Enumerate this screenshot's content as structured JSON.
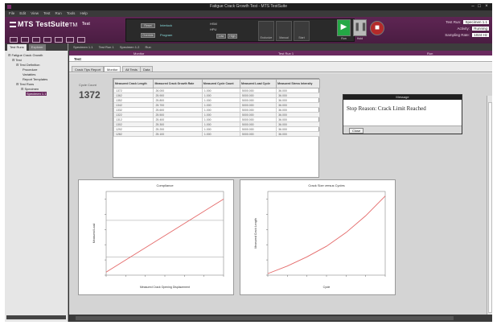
{
  "window": {
    "title": "Fatigue Crack Growth Test - MTS TestSuite"
  },
  "menu": [
    "File",
    "Edit",
    "View",
    "Test",
    "Run",
    "Tools",
    "Help"
  ],
  "app": {
    "logo_main": "MTS TestSuite",
    "logo_sub": "TM",
    "connection": "Test"
  },
  "station": {
    "btn_reset": "Reset",
    "btn_override": "Override",
    "lcd1": "Interlock",
    "lcd2": "Program",
    "hsm_label": "HSM",
    "hpu_label": "HPU",
    "btn_low": "Low",
    "btn_high": "High",
    "big_controls": [
      "Exclusive",
      "Manual",
      "Start",
      "Hold",
      "Stop"
    ]
  },
  "run_controls": {
    "run": "Run",
    "hold": "Hold",
    "stop": "Stop"
  },
  "right_info": {
    "test_run_label": "Test Run:",
    "test_run_value": "Specimen 1.1",
    "activity_label": "Activity:",
    "activity_value": "Running",
    "scope_label": "Sampling Rate:",
    "scope_value": "1024 Hz"
  },
  "doc_tabs": [
    "Specimen 1.1",
    "Test Run 1",
    "Specimen 1.2",
    "Run"
  ],
  "explorer": {
    "tabs": [
      "Test Runs",
      "Explorer"
    ],
    "tree": [
      "Fatigue Crack Growth",
      "Test",
      "Test Definition",
      "Procedure",
      "Variables",
      "Report Templates",
      "Test Runs",
      "Specimen",
      "Specimen 1.1"
    ]
  },
  "main": {
    "strip_left": "Monitor",
    "strip_mid": "Test Run 1",
    "strip_right": "Run",
    "section": "Test",
    "view_tabs": [
      "Crack Tips Report",
      "Monitor",
      "All Tests",
      "Data"
    ],
    "cycle_label": "Cycle Count",
    "cycle_value": "1372"
  },
  "table": {
    "headers": [
      "Measured Crack Length",
      "Measured Crack Growth Rate",
      "Measured Cycle Count",
      "Measured Load Cycle",
      "Measured Stress Intensity"
    ],
    "rows": [
      [
        "1372",
        "26.000",
        "1.000",
        "5000.000",
        "36.000"
      ],
      [
        "1362",
        "25.900",
        "1.000",
        "5000.000",
        "36.000"
      ],
      [
        "1352",
        "25.800",
        "1.000",
        "5000.000",
        "36.000"
      ],
      [
        "1342",
        "25.700",
        "1.000",
        "5000.000",
        "36.000"
      ],
      [
        "1332",
        "25.600",
        "1.000",
        "5000.000",
        "36.000"
      ],
      [
        "1322",
        "25.500",
        "1.000",
        "5000.000",
        "36.000"
      ],
      [
        "1312",
        "25.400",
        "1.000",
        "5000.000",
        "36.000"
      ],
      [
        "1302",
        "25.300",
        "1.000",
        "5000.000",
        "36.000"
      ],
      [
        "1292",
        "25.200",
        "1.000",
        "5000.000",
        "36.000"
      ],
      [
        "1282",
        "25.100",
        "1.000",
        "5000.000",
        "36.000"
      ]
    ]
  },
  "dialog": {
    "title": "Message",
    "body": "Stop Reason: Crack Limit Reached",
    "ok_label": "Close"
  },
  "chart_data": [
    {
      "type": "line",
      "title": "Compliance",
      "xlabel": "Measured Crack Opening Displacement",
      "ylabel": "Measured Load",
      "x": [
        0,
        1,
        2,
        3,
        4,
        5,
        6
      ],
      "series": [
        {
          "values": [
            0.2,
            1.0,
            1.8,
            2.6,
            3.4,
            4.2,
            5.0
          ],
          "color": "#e46a6a"
        }
      ],
      "hlines": [
        1.2,
        3.6
      ],
      "xlim": [
        0,
        6
      ],
      "ylim": [
        0,
        5.5
      ]
    },
    {
      "type": "line",
      "title": "Crack Size versus Cycles",
      "xlabel": "Cycle",
      "ylabel": "Measured Crack Length",
      "x": [
        0,
        1,
        2,
        3,
        4,
        5,
        6
      ],
      "series": [
        {
          "values": [
            0.1,
            0.6,
            1.2,
            1.9,
            2.8,
            3.9,
            5.2
          ],
          "color": "#e46a6a"
        }
      ],
      "xlim": [
        0,
        6
      ],
      "ylim": [
        0,
        5.5
      ]
    }
  ]
}
